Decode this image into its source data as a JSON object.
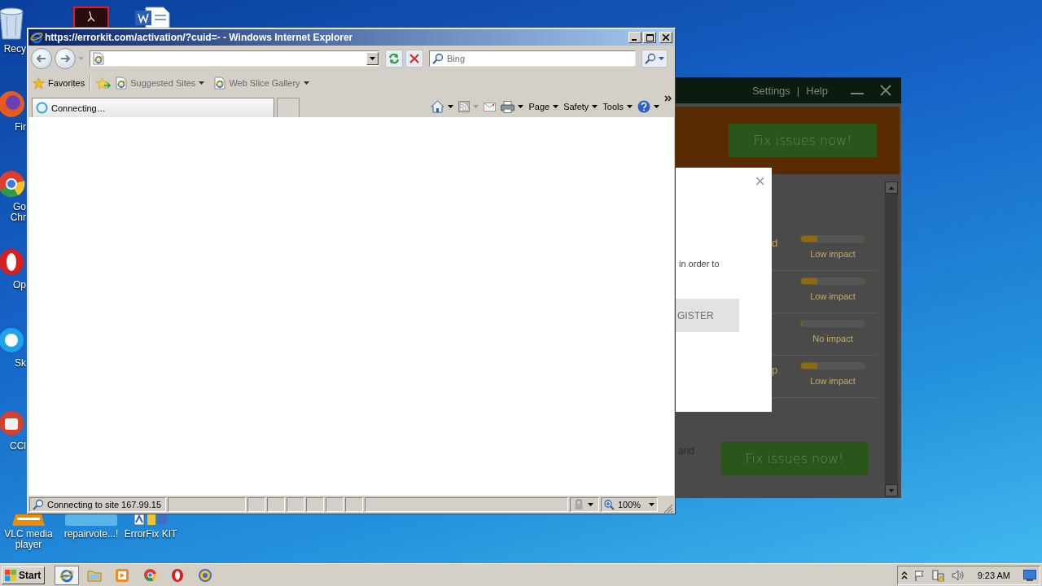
{
  "desktop_icons": [
    {
      "kind": "recycle",
      "label": "Recy"
    },
    {
      "kind": "pdf"
    },
    {
      "kind": "word"
    },
    {
      "kind": "firefox",
      "label": "Fir"
    },
    {
      "kind": "chrome",
      "label": "Go Chr"
    },
    {
      "kind": "opera",
      "label": "Op"
    },
    {
      "kind": "skype",
      "label": "Sk"
    },
    {
      "kind": "ccleaner",
      "label": "CCl"
    },
    {
      "kind": "vlc",
      "label": "VLC media player"
    },
    {
      "kind": "repair",
      "label": "repairvote...!"
    },
    {
      "kind": "errorfix",
      "label": "ErrorFix KIT"
    }
  ],
  "background_app": {
    "menu": [
      "Settings",
      "Help"
    ],
    "separator": "|",
    "top_button": "Fix issues now!",
    "dialog": {
      "close": "×",
      "text": "in order to",
      "button": "GISTER"
    },
    "rows": [
      {
        "label": "d",
        "level": 0.25,
        "impact": "Low impact"
      },
      {
        "level": 0.25,
        "impact": "Low impact"
      },
      {
        "level": 0,
        "impact": "No impact"
      },
      {
        "label": "p",
        "level": 0.25,
        "impact": "Low impact"
      }
    ],
    "footer_text": "and",
    "bottom_button": "Fix issues now!"
  },
  "browser": {
    "title": "https://errorkit.com/activation/?cuid=- - Windows Internet Explorer",
    "search": {
      "placeholder": "Bing"
    },
    "favorites": "Favorites",
    "links": [
      "Suggested Sites",
      "Web Slice Gallery"
    ],
    "tab": {
      "label": "Connecting…",
      "selected": true
    },
    "commands": [
      "Page",
      "Safety",
      "Tools"
    ],
    "status": "Connecting to site 167.99.15",
    "zoom": "100%"
  },
  "taskbar": {
    "start": "Start",
    "apps": [
      {
        "kind": "ie",
        "selected": true
      },
      {
        "kind": "folder",
        "selected": false
      },
      {
        "kind": "media",
        "selected": false
      },
      {
        "kind": "chrome",
        "selected": false
      },
      {
        "kind": "opera",
        "selected": false
      },
      {
        "kind": "tool",
        "selected": false
      }
    ],
    "clock": "9:23 AM"
  }
}
